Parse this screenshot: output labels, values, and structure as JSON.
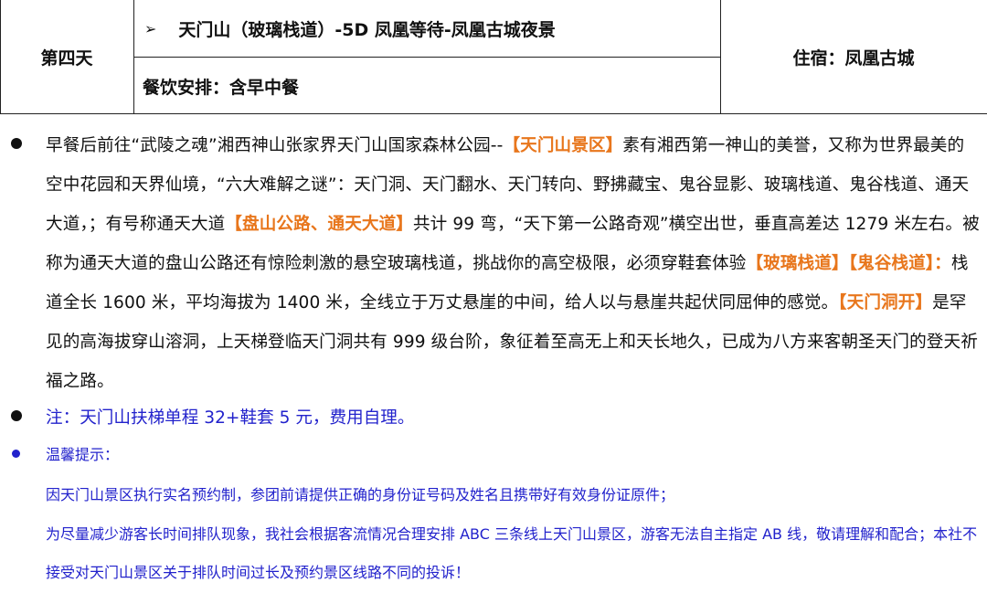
{
  "header": {
    "day": "第四天",
    "route_arrow": "➢",
    "route": "天门山（玻璃栈道）-5D 凤凰等待-凤凰古城夜景",
    "meals": "餐饮安排：含早中餐",
    "stay": "住宿：凤凰古城"
  },
  "main": {
    "para": [
      {
        "t": "早餐后前往“武陵之魂”湘西神山张家界天门山国家森林公园--",
        "o": false
      },
      {
        "t": "【天门山景区】",
        "o": true
      },
      {
        "t": "素有湘西第一神山的美誉，又称为世界最美的空中花园和天界仙境，“六大难解之谜”：天门洞、天门翻水、天门转向、野拂藏宝、鬼谷显影、玻璃栈道、鬼谷栈道、通天大道，；有号称通天大道",
        "o": false
      },
      {
        "t": "【盘山公路、通天大道】",
        "o": true
      },
      {
        "t": "共计 99 弯，“天下第一公路奇观”横空出世，垂直高差达 1279 米左右。被称为通天大道的盘山公路还有惊险刺激的悬空玻璃栈道，挑战你的高空极限，必须穿鞋套体验",
        "o": false
      },
      {
        "t": "【玻璃栈道】【鬼谷栈道】：",
        "o": true
      },
      {
        "t": "栈道全长 1600 米，平均海拔为 1400 米，全线立于万丈悬崖的中间，给人以与悬崖共起伏同屈伸的感觉。",
        "o": false
      },
      {
        "t": "【天门洞开】",
        "o": true
      },
      {
        "t": "是罕见的高海拔穿山溶洞，上天梯登临天门洞共有 999 级台阶，象征着至高无上和天长地久，已成为八方来客朝圣天门的登天祈福之路。",
        "o": false
      }
    ],
    "note": "注：天门山扶梯单程 32+鞋套 5 元，费用自理。",
    "tips_title": "温馨提示：",
    "tips": [
      "因天门山景区执行实名预约制，参团前请提供正确的身份证号码及姓名且携带好有效身份证原件；",
      "为尽量减少游客长时间排队现象，我社会根据客流情况合理安排 ABC 三条线上天门山景区，游客无法自主指定 AB 线，敬请理解和配合；本社不接受对天门山景区关于排队时间过长及预约景区线路不同的投诉！"
    ]
  }
}
